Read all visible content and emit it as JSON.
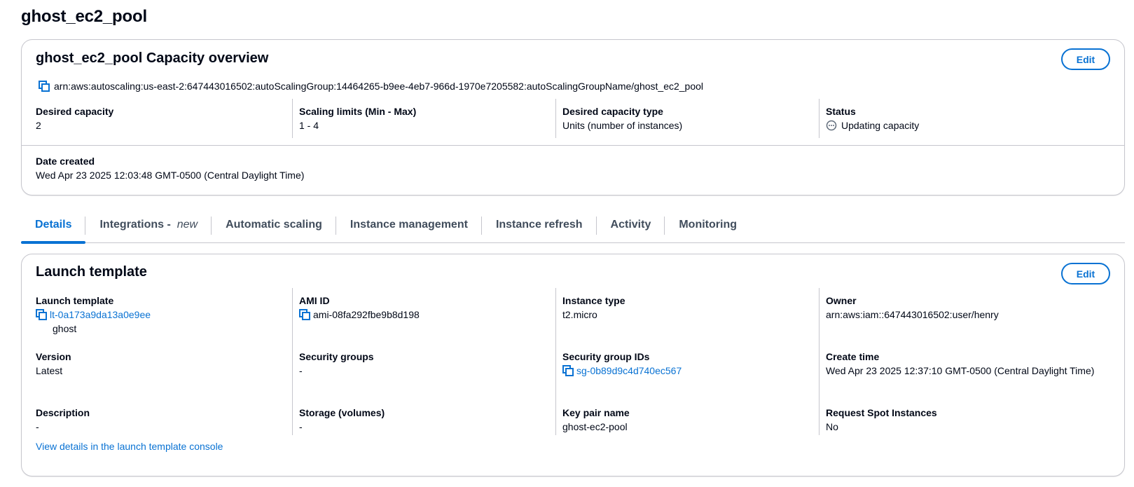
{
  "page": {
    "title": "ghost_ec2_pool"
  },
  "overview": {
    "title": "ghost_ec2_pool Capacity overview",
    "edit_label": "Edit",
    "arn": "arn:aws:autoscaling:us-east-2:647443016502:autoScalingGroup:14464265-b9ee-4eb7-966d-1970e7205582:autoScalingGroupName/ghost_ec2_pool",
    "desired_capacity": {
      "label": "Desired capacity",
      "value": "2"
    },
    "scaling_limits": {
      "label": "Scaling limits (Min - Max)",
      "value": "1 - 4"
    },
    "capacity_type": {
      "label": "Desired capacity type",
      "value": "Units (number of instances)"
    },
    "status": {
      "label": "Status",
      "value": "Updating capacity",
      "icon": "pending-dots-icon"
    },
    "date_created": {
      "label": "Date created",
      "value": "Wed Apr 23 2025 12:03:48 GMT-0500 (Central Daylight Time)"
    }
  },
  "tabs": [
    {
      "label": "Details",
      "active": true
    },
    {
      "label": "Integrations - ",
      "suffix": "new"
    },
    {
      "label": "Automatic scaling"
    },
    {
      "label": "Instance management"
    },
    {
      "label": "Instance refresh"
    },
    {
      "label": "Activity"
    },
    {
      "label": "Monitoring"
    }
  ],
  "launch": {
    "title": "Launch template",
    "edit_label": "Edit",
    "template": {
      "label": "Launch template",
      "id": "lt-0a173a9da13a0e9ee",
      "name": "ghost"
    },
    "ami": {
      "label": "AMI ID",
      "value": "ami-08fa292fbe9b8d198"
    },
    "instance_type": {
      "label": "Instance type",
      "value": "t2.micro"
    },
    "owner": {
      "label": "Owner",
      "value": "arn:aws:iam::647443016502:user/henry"
    },
    "version": {
      "label": "Version",
      "value": "Latest"
    },
    "security_groups": {
      "label": "Security groups",
      "value": "-"
    },
    "security_group_ids": {
      "label": "Security group IDs",
      "value": "sg-0b89d9c4d740ec567"
    },
    "create_time": {
      "label": "Create time",
      "value": "Wed Apr 23 2025 12:37:10 GMT-0500 (Central Daylight Time)"
    },
    "description": {
      "label": "Description",
      "value": "-"
    },
    "storage": {
      "label": "Storage (volumes)",
      "value": "-"
    },
    "key_pair": {
      "label": "Key pair name",
      "value": "ghost-ec2-pool"
    },
    "spot": {
      "label": "Request Spot Instances",
      "value": "No"
    },
    "console_link": "View details in the launch template console"
  },
  "colors": {
    "link": "#0972d3",
    "text": "#000716",
    "border": "#c6c6cd",
    "muted": "#5f6b7a"
  }
}
